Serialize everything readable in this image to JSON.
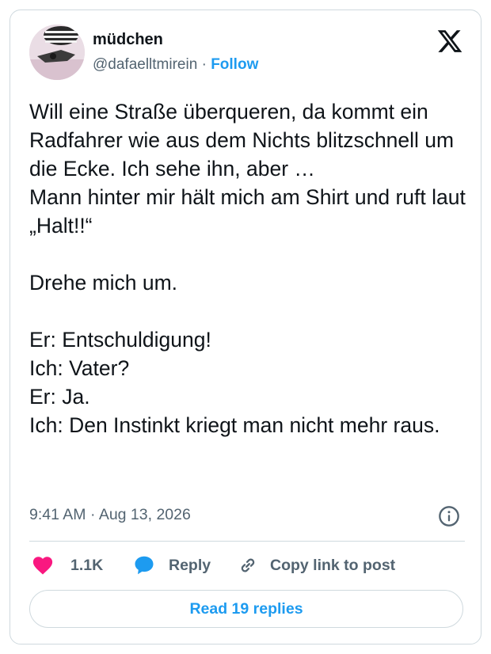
{
  "author": {
    "name": "müdchen",
    "handle": "@dafaelltmirein",
    "separator": "·",
    "follow_label": "Follow"
  },
  "tweet": {
    "text": "Will eine Straße überqueren, da kommt ein Radfahrer wie aus dem Nichts blitzschnell um die Ecke. Ich sehe ihn, aber …\nMann hinter mir hält mich am Shirt und ruft laut „Halt!!“\n\nDrehe mich um.\n\nEr: Entschuldigung!\nIch: Vater?\nEr: Ja.\nIch: Den Instinkt kriegt man nicht mehr raus.",
    "time": "9:41 AM",
    "separator": "·",
    "date": "Aug 13, 2026"
  },
  "actions": {
    "like_count": "1.1K",
    "reply_label": "Reply",
    "copy_link_label": "Copy link to post"
  },
  "read_replies_label": "Read 19 replies",
  "colors": {
    "accent": "#1d9bf0",
    "like": "#f91880",
    "text": "#0f1419",
    "muted": "#536471",
    "border": "#cfd9de"
  },
  "icons": [
    "x-logo-icon",
    "info-icon",
    "heart-icon",
    "reply-bubble-icon",
    "link-icon"
  ]
}
